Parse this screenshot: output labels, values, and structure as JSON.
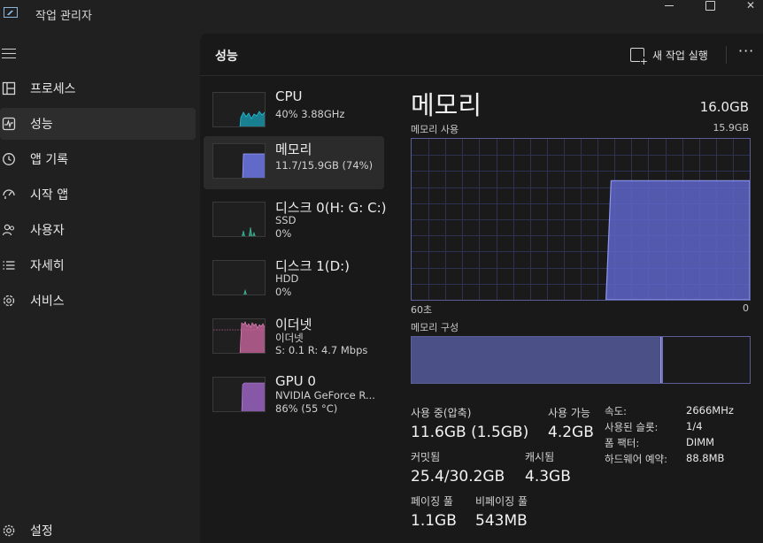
{
  "app": {
    "title": "작업 관리자"
  },
  "nav": {
    "items": [
      {
        "label": "프로세스",
        "icon": "grid-icon"
      },
      {
        "label": "성능",
        "icon": "performance-icon"
      },
      {
        "label": "앱 기록",
        "icon": "history-icon"
      },
      {
        "label": "시작 앱",
        "icon": "startup-icon"
      },
      {
        "label": "사용자",
        "icon": "users-icon"
      },
      {
        "label": "자세히",
        "icon": "details-icon"
      },
      {
        "label": "서비스",
        "icon": "services-icon"
      }
    ],
    "settings_label": "설정"
  },
  "header": {
    "title": "성능",
    "run_task_label": "새 작업 실행",
    "more_label": "···"
  },
  "devices": [
    {
      "name": "CPU",
      "sub1": "40% 3.88GHz",
      "sub2": "",
      "color": "#17a2b8"
    },
    {
      "name": "메모리",
      "sub1": "11.7/15.9GB (74%)",
      "sub2": "",
      "color": "#6f78e8"
    },
    {
      "name": "디스크 0(H: G: C:)",
      "sub1": "SSD",
      "sub2": "0%",
      "color": "#35a98f"
    },
    {
      "name": "디스크 1(D:)",
      "sub1": "HDD",
      "sub2": "0%",
      "color": "#35a98f"
    },
    {
      "name": "이더넷",
      "sub1": "이더넷",
      "sub2": "S: 0.1  R: 4.7 Mbps",
      "color": "#d36aa6"
    },
    {
      "name": "GPU 0",
      "sub1": "NVIDIA GeForce R...",
      "sub2": "86% (55 °C)",
      "color": "#a067c9"
    }
  ],
  "memory": {
    "title": "메모리",
    "capacity": "16.0GB",
    "usage_label": "메모리 사용",
    "usage_max": "15.9GB",
    "time_left": "60초",
    "time_right": "0",
    "composition_label": "메모리 구성",
    "usage_level_fraction": 0.74,
    "stats": {
      "in_use_label": "사용 중(압축)",
      "in_use_value": "11.6GB (1.5GB)",
      "available_label": "사용 가능",
      "available_value": "4.2GB",
      "committed_label": "커밋됨",
      "committed_value": "25.4/30.2GB",
      "cached_label": "캐시됨",
      "cached_value": "4.3GB",
      "paged_label": "페이징 풀",
      "paged_value": "1.1GB",
      "nonpaged_label": "비페이징 풀",
      "nonpaged_value": "543MB"
    },
    "specs": [
      {
        "key": "속도:",
        "value": "2666MHz"
      },
      {
        "key": "사용된 슬롯:",
        "value": "1/4"
      },
      {
        "key": "폼 팩터:",
        "value": "DIMM"
      },
      {
        "key": "하드웨어 예약:",
        "value": "88.8MB"
      }
    ]
  }
}
